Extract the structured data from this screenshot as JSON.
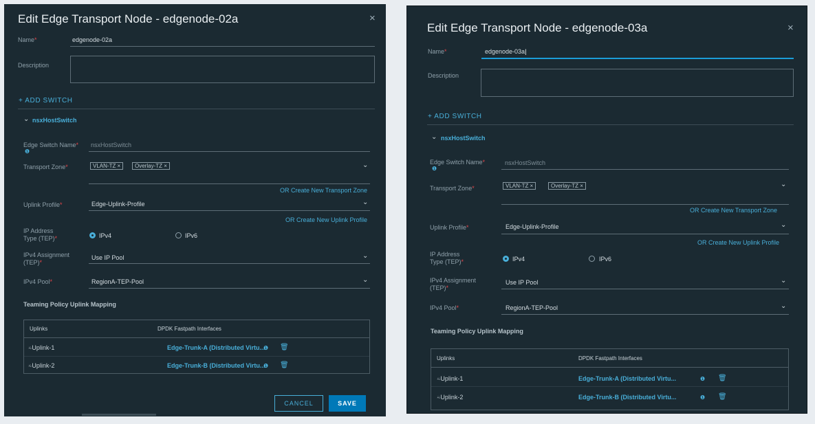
{
  "dialogs": [
    {
      "title": "Edit Edge Transport Node - edgenode-02a",
      "close_glyph": "×",
      "name_label": "Name",
      "name_value": "edgenode-02a",
      "description_label": "Description",
      "add_switch_label": "+ ADD SWITCH",
      "switch_toggle": "⌄",
      "switch_name": "nsxHostSwitch",
      "edge_switch_name_label": "Edge Switch Name",
      "edge_switch_name_placeholder": "nsxHostSwitch",
      "info_glyph": "❶",
      "transport_zone_label": "Transport Zone",
      "transport_zone_chips": [
        "VLAN-TZ  ×",
        "Overlay-TZ  ×"
      ],
      "create_transport_zone_link": "OR Create New Transport Zone",
      "uplink_profile_label": "Uplink Profile",
      "uplink_profile_value": "Edge-Uplink-Profile",
      "create_uplink_profile_link": "OR Create New Uplink Profile",
      "ip_type_label_1": "IP Address",
      "ip_type_label_2": "Type (TEP)",
      "ipv4_label": "IPv4",
      "ipv6_label": "IPv6",
      "ipv4_assignment_label_1": "IPv4 Assignment",
      "ipv4_assignment_label_2": "(TEP)",
      "ipv4_assignment_value": "Use IP Pool",
      "ipv4_pool_label": "IPv4 Pool",
      "ipv4_pool_value": "RegionA-TEP-Pool",
      "teaming_heading": "Teaming Policy Uplink Mapping",
      "table_headers": [
        "Uplinks",
        "DPDK Fastpath Interfaces"
      ],
      "rows": [
        {
          "uplink": "Uplink-1",
          "iface": "Edge-Trunk-A (Distributed Virtu..."
        },
        {
          "uplink": "Uplink-2",
          "iface": "Edge-Trunk-B (Distributed Virtu..."
        }
      ],
      "uplink_glyph": "⍨",
      "trash_glyph": "🗑",
      "cancel_label": "CANCEL",
      "save_label": "SAVE"
    },
    {
      "title": "Edit Edge Transport Node - edgenode-03a",
      "close_glyph": "×",
      "name_label": "Name",
      "name_value": "edgenode-03a",
      "description_label": "Description",
      "add_switch_label": "+ ADD SWITCH",
      "switch_toggle": "⌄",
      "switch_name": "nsxHostSwitch",
      "edge_switch_name_label": "Edge Switch Name",
      "edge_switch_name_placeholder": "nsxHostSwitch",
      "info_glyph": "❶",
      "transport_zone_label": "Transport Zone",
      "transport_zone_chips": [
        "VLAN-TZ  ×",
        "Overlay-TZ  ×"
      ],
      "create_transport_zone_link": "OR Create New Transport Zone",
      "uplink_profile_label": "Uplink Profile",
      "uplink_profile_value": "Edge-Uplink-Profile",
      "create_uplink_profile_link": "OR Create New Uplink Profile",
      "ip_type_label_1": "IP Address",
      "ip_type_label_2": "Type (TEP)",
      "ipv4_label": "IPv4",
      "ipv6_label": "IPv6",
      "ipv4_assignment_label_1": "IPv4 Assignment",
      "ipv4_assignment_label_2": "(TEP)",
      "ipv4_assignment_value": "Use IP Pool",
      "ipv4_pool_label": "IPv4 Pool",
      "ipv4_pool_value": "RegionA-TEP-Pool",
      "teaming_heading": "Teaming Policy Uplink Mapping",
      "table_headers": [
        "Uplinks",
        "DPDK Fastpath Interfaces"
      ],
      "rows": [
        {
          "uplink": "Uplink-1",
          "iface": "Edge-Trunk-A (Distributed Virtu..."
        },
        {
          "uplink": "Uplink-2",
          "iface": "Edge-Trunk-B (Distributed Virtu..."
        }
      ],
      "uplink_glyph": "⍨",
      "trash_glyph": "🗑"
    }
  ],
  "required_marker": "*",
  "chevron_glyph": "⌄",
  "colors": {
    "dialog_bg": "#1b2a32",
    "accent": "#49afd9",
    "primary_button": "#0079b8",
    "required": "#e0464b"
  }
}
